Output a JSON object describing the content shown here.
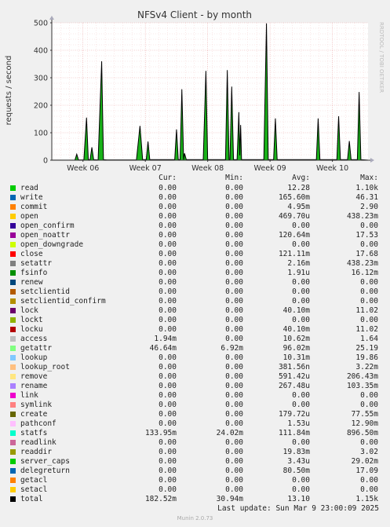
{
  "chart_data": {
    "type": "line",
    "title": "NFSv4 Client - by month",
    "ylabel": "requests / second",
    "watermark": "RRDTOOL / TOBI OETIKER",
    "ylim": [
      0,
      500
    ],
    "yticks": [
      0,
      100,
      200,
      300,
      400,
      500
    ],
    "xticks": [
      "Week 06",
      "Week 07",
      "Week 08",
      "Week 09",
      "Week 10"
    ],
    "xticks_pos": [
      0.5,
      7.5,
      14.5,
      21.5,
      28.5
    ],
    "xlim": [
      -3.0,
      32.5
    ],
    "grid": true,
    "series": [
      {
        "name": "total",
        "color": "#000000",
        "fill": "#00aa00",
        "points": [
          [
            -3.0,
            0.5
          ],
          [
            -1.0,
            0.5
          ],
          [
            -0.4,
            0.8
          ],
          [
            -0.2,
            22
          ],
          [
            0.0,
            1.0
          ],
          [
            0.6,
            1.0
          ],
          [
            0.9,
            155
          ],
          [
            1.1,
            2.0
          ],
          [
            1.3,
            2.0
          ],
          [
            1.5,
            47
          ],
          [
            1.7,
            2.0
          ],
          [
            2.2,
            1.0
          ],
          [
            2.6,
            360
          ],
          [
            2.8,
            2.0
          ],
          [
            3.2,
            1.0
          ],
          [
            6.5,
            1.0
          ],
          [
            6.9,
            125
          ],
          [
            7.2,
            2.0
          ],
          [
            7.6,
            2.0
          ],
          [
            7.8,
            68
          ],
          [
            8.0,
            2.0
          ],
          [
            10.8,
            2.0
          ],
          [
            11.0,
            112
          ],
          [
            11.2,
            2.0
          ],
          [
            11.4,
            2.0
          ],
          [
            11.6,
            258
          ],
          [
            11.8,
            2.0
          ],
          [
            11.9,
            25
          ],
          [
            12.1,
            2.0
          ],
          [
            14.0,
            2.0
          ],
          [
            14.3,
            325
          ],
          [
            14.5,
            2.0
          ],
          [
            16.5,
            2.0
          ],
          [
            16.7,
            328
          ],
          [
            16.9,
            2.0
          ],
          [
            17.0,
            2.0
          ],
          [
            17.2,
            268
          ],
          [
            17.4,
            2.0
          ],
          [
            17.8,
            2.0
          ],
          [
            18.0,
            175
          ],
          [
            18.1,
            18
          ],
          [
            18.2,
            128
          ],
          [
            18.3,
            2.0
          ],
          [
            20.8,
            2.0
          ],
          [
            21.1,
            498
          ],
          [
            21.3,
            2.0
          ],
          [
            21.9,
            2.0
          ],
          [
            22.1,
            152
          ],
          [
            22.3,
            2.0
          ],
          [
            26.7,
            2.0
          ],
          [
            26.9,
            152
          ],
          [
            27.1,
            2.0
          ],
          [
            29.0,
            2.0
          ],
          [
            29.2,
            160
          ],
          [
            29.4,
            2.0
          ],
          [
            30.2,
            2.0
          ],
          [
            30.4,
            70
          ],
          [
            30.6,
            2.0
          ],
          [
            31.3,
            2.0
          ],
          [
            31.5,
            248
          ],
          [
            31.7,
            2.0
          ],
          [
            32.5,
            0.5
          ]
        ]
      }
    ],
    "legend_header": {
      "cur": "Cur:",
      "min": "Min:",
      "avg": "Avg:",
      "max": "Max:"
    },
    "legend": [
      {
        "name": "read",
        "color": "#00cc00",
        "cur": "0.00",
        "min": "0.00",
        "avg": "12.28",
        "max": "1.10k"
      },
      {
        "name": "write",
        "color": "#0066b3",
        "cur": "0.00",
        "min": "0.00",
        "avg": "165.60m",
        "max": "46.31"
      },
      {
        "name": "commit",
        "color": "#ff8000",
        "cur": "0.00",
        "min": "0.00",
        "avg": "4.95m",
        "max": "2.90"
      },
      {
        "name": "open",
        "color": "#ffcc00",
        "cur": "0.00",
        "min": "0.00",
        "avg": "469.70u",
        "max": "438.23m"
      },
      {
        "name": "open_confirm",
        "color": "#330099",
        "cur": "0.00",
        "min": "0.00",
        "avg": "0.00",
        "max": "0.00"
      },
      {
        "name": "open_noattr",
        "color": "#990099",
        "cur": "0.00",
        "min": "0.00",
        "avg": "120.64m",
        "max": "17.53"
      },
      {
        "name": "open_downgrade",
        "color": "#ccff00",
        "cur": "0.00",
        "min": "0.00",
        "avg": "0.00",
        "max": "0.00"
      },
      {
        "name": "close",
        "color": "#ff0000",
        "cur": "0.00",
        "min": "0.00",
        "avg": "121.11m",
        "max": "17.68"
      },
      {
        "name": "setattr",
        "color": "#808080",
        "cur": "0.00",
        "min": "0.00",
        "avg": "2.16m",
        "max": "438.23m"
      },
      {
        "name": "fsinfo",
        "color": "#008f00",
        "cur": "0.00",
        "min": "0.00",
        "avg": "1.91u",
        "max": "16.12m"
      },
      {
        "name": "renew",
        "color": "#00487d",
        "cur": "0.00",
        "min": "0.00",
        "avg": "0.00",
        "max": "0.00"
      },
      {
        "name": "setclientid",
        "color": "#b35a00",
        "cur": "0.00",
        "min": "0.00",
        "avg": "0.00",
        "max": "0.00"
      },
      {
        "name": "setclientid_confirm",
        "color": "#b38f00",
        "cur": "0.00",
        "min": "0.00",
        "avg": "0.00",
        "max": "0.00"
      },
      {
        "name": "lock",
        "color": "#6b006b",
        "cur": "0.00",
        "min": "0.00",
        "avg": "40.10m",
        "max": "11.02"
      },
      {
        "name": "lockt",
        "color": "#8fb300",
        "cur": "0.00",
        "min": "0.00",
        "avg": "0.00",
        "max": "0.00"
      },
      {
        "name": "locku",
        "color": "#b30000",
        "cur": "0.00",
        "min": "0.00",
        "avg": "40.10m",
        "max": "11.02"
      },
      {
        "name": "access",
        "color": "#bebebe",
        "cur": "1.94m",
        "min": "0.00",
        "avg": "10.62m",
        "max": "1.64"
      },
      {
        "name": "getattr",
        "color": "#80ff80",
        "cur": "46.64m",
        "min": "6.92m",
        "avg": "96.02m",
        "max": "25.19"
      },
      {
        "name": "lookup",
        "color": "#80c9ff",
        "cur": "0.00",
        "min": "0.00",
        "avg": "10.31m",
        "max": "19.86"
      },
      {
        "name": "lookup_root",
        "color": "#ffc080",
        "cur": "0.00",
        "min": "0.00",
        "avg": "381.56n",
        "max": "3.22m"
      },
      {
        "name": "remove",
        "color": "#ffe680",
        "cur": "0.00",
        "min": "0.00",
        "avg": "591.42u",
        "max": "206.43m"
      },
      {
        "name": "rename",
        "color": "#aa80ff",
        "cur": "0.00",
        "min": "0.00",
        "avg": "267.48u",
        "max": "103.35m"
      },
      {
        "name": "link",
        "color": "#ee00cc",
        "cur": "0.00",
        "min": "0.00",
        "avg": "0.00",
        "max": "0.00"
      },
      {
        "name": "symlink",
        "color": "#ff8080",
        "cur": "0.00",
        "min": "0.00",
        "avg": "0.00",
        "max": "0.00"
      },
      {
        "name": "create",
        "color": "#666600",
        "cur": "0.00",
        "min": "0.00",
        "avg": "179.72u",
        "max": "77.55m"
      },
      {
        "name": "pathconf",
        "color": "#ffbfff",
        "cur": "0.00",
        "min": "0.00",
        "avg": "1.53u",
        "max": "12.90m"
      },
      {
        "name": "statfs",
        "color": "#00ffcc",
        "cur": "133.95m",
        "min": "24.02m",
        "avg": "111.84m",
        "max": "896.50m"
      },
      {
        "name": "readlink",
        "color": "#cc6699",
        "cur": "0.00",
        "min": "0.00",
        "avg": "0.00",
        "max": "0.00"
      },
      {
        "name": "readdir",
        "color": "#999900",
        "cur": "0.00",
        "min": "0.00",
        "avg": "19.83m",
        "max": "3.02"
      },
      {
        "name": "server_caps",
        "color": "#00cc00",
        "cur": "0.00",
        "min": "0.00",
        "avg": "3.43u",
        "max": "29.02m"
      },
      {
        "name": "delegreturn",
        "color": "#0066b3",
        "cur": "0.00",
        "min": "0.00",
        "avg": "80.50m",
        "max": "17.09"
      },
      {
        "name": "getacl",
        "color": "#ff8000",
        "cur": "0.00",
        "min": "0.00",
        "avg": "0.00",
        "max": "0.00"
      },
      {
        "name": "setacl",
        "color": "#ffcc00",
        "cur": "0.00",
        "min": "0.00",
        "avg": "0.00",
        "max": "0.00"
      },
      {
        "name": "total",
        "color": "#000000",
        "cur": "182.52m",
        "min": "30.94m",
        "avg": "13.10",
        "max": "1.15k"
      }
    ],
    "last_update": "Last update: Sun Mar  9 23:00:09 2025",
    "footer": "Munin 2.0.73"
  }
}
